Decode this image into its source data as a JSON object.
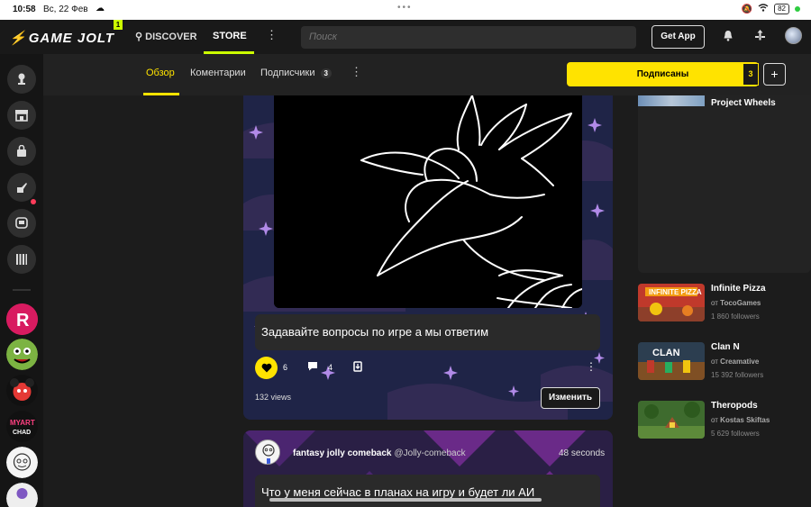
{
  "status_bar": {
    "time": "10:58",
    "date": "Вс, 22 Фев",
    "battery": "82"
  },
  "top_nav": {
    "logo": "GAME JOLT",
    "logo_badge": "1",
    "discover": "DISCOVER",
    "store": "STORE",
    "search_placeholder": "Поиск",
    "get_app": "Get App"
  },
  "subnav": {
    "tabs": [
      {
        "label": "Обзор",
        "active": true
      },
      {
        "label": "Коментарии"
      },
      {
        "label": "Подписчики",
        "badge": "3"
      }
    ],
    "follow_label": "Подписаны",
    "follow_count": "3",
    "add_label": "+"
  },
  "post": {
    "title": "Задавайте вопросы по игре а мы ответим",
    "likes": "6",
    "comments": "4",
    "views": "132 views",
    "edit_label": "Изменить"
  },
  "post2": {
    "author": "fantasy jolly comeback",
    "handle": "@Jolly-comeback",
    "time": "48 seconds",
    "title": "Что у меня сейчас в планах на игру и будет ли АИ"
  },
  "right_column": {
    "partial_title": "Project Wheels",
    "games": [
      {
        "title": "Infinite Pizza",
        "dev_prefix": "от",
        "dev": "TocoGames",
        "followers": "1 860 followers",
        "thumb": "pizza"
      },
      {
        "title": "Clan N",
        "dev_prefix": "от",
        "dev": "Creamative",
        "followers": "15 392 followers",
        "thumb": "clan"
      },
      {
        "title": "Theropods",
        "dev_prefix": "от",
        "dev": "Kostas Skiftas",
        "followers": "5 629 followers",
        "thumb": "theropods"
      }
    ]
  },
  "colors": {
    "accent": "#ffe300",
    "background": "#1c1c1c",
    "post_bg": "#1d2240"
  }
}
